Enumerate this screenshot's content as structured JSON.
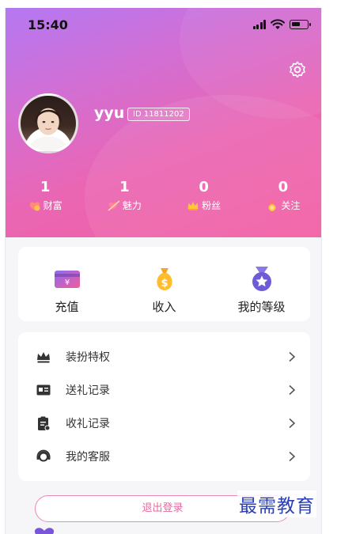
{
  "status_bar": {
    "time": "15:40"
  },
  "profile": {
    "nickname": "yyu",
    "id_label": "ID 11811202"
  },
  "stats": [
    {
      "value": "1",
      "label": "财富",
      "icon": "wealth-icon"
    },
    {
      "value": "1",
      "label": "魅力",
      "icon": "charm-icon"
    },
    {
      "value": "0",
      "label": "粉丝",
      "icon": "crown-icon"
    },
    {
      "value": "0",
      "label": "关注",
      "icon": "medal-icon"
    }
  ],
  "quick_actions": [
    {
      "label": "充值",
      "icon": "wallet-icon"
    },
    {
      "label": "收入",
      "icon": "money-bag-icon"
    },
    {
      "label": "我的等级",
      "icon": "level-medal-icon"
    }
  ],
  "menu": [
    {
      "label": "装扮特权",
      "icon": "crown-outline-icon"
    },
    {
      "label": "送礼记录",
      "icon": "id-card-icon"
    },
    {
      "label": "收礼记录",
      "icon": "clipboard-icon"
    },
    {
      "label": "我的客服",
      "icon": "headset-icon"
    }
  ],
  "logout_label": "退出登录",
  "watermark": "最需教育",
  "colors": {
    "hero_gradient_start": "#b478f2",
    "hero_gradient_end": "#f25ea2",
    "logout_accent": "#e6699e",
    "watermark": "#2b3fb3"
  }
}
